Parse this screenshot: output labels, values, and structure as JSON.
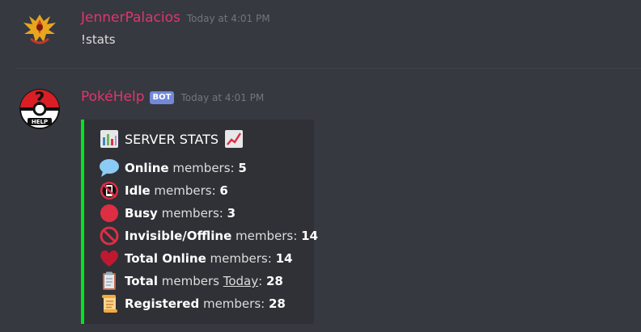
{
  "messages": [
    {
      "username": "JennerPalacios",
      "timestamp": "Today at 4:01 PM",
      "content": "!stats",
      "avatar_icon": "moltres-icon"
    },
    {
      "username": "PokéHelp",
      "bot_tag": "BOT",
      "timestamp": "Today at 4:01 PM",
      "avatar_icon": "pokeball-help-icon",
      "embed": {
        "accent_color": "#00e51f",
        "title": "SERVER STATS",
        "title_icons": [
          "bar-chart-icon",
          "chart-increasing-icon"
        ],
        "stats": [
          {
            "icon": "speech-bubble-icon",
            "bold": "Online",
            "text": " members: ",
            "value": "5"
          },
          {
            "icon": "no-mobile-phones-icon",
            "bold": "Idle",
            "text": " members: ",
            "value": "6"
          },
          {
            "icon": "red-circle-icon",
            "bold": "Busy",
            "text": " members: ",
            "value": "3"
          },
          {
            "icon": "prohibited-icon",
            "bold": "Invisible/Offline",
            "text": " members: ",
            "value": "14"
          },
          {
            "icon": "red-heart-icon",
            "bold": "Total Online",
            "text": " members: ",
            "value": "14"
          },
          {
            "icon": "clipboard-icon",
            "bold": "Total",
            "text": " members ",
            "underline": "Today",
            "suffix": ": ",
            "value": "28"
          },
          {
            "icon": "scroll-icon",
            "bold": "Registered",
            "text": " members: ",
            "value": "28"
          }
        ]
      }
    }
  ]
}
